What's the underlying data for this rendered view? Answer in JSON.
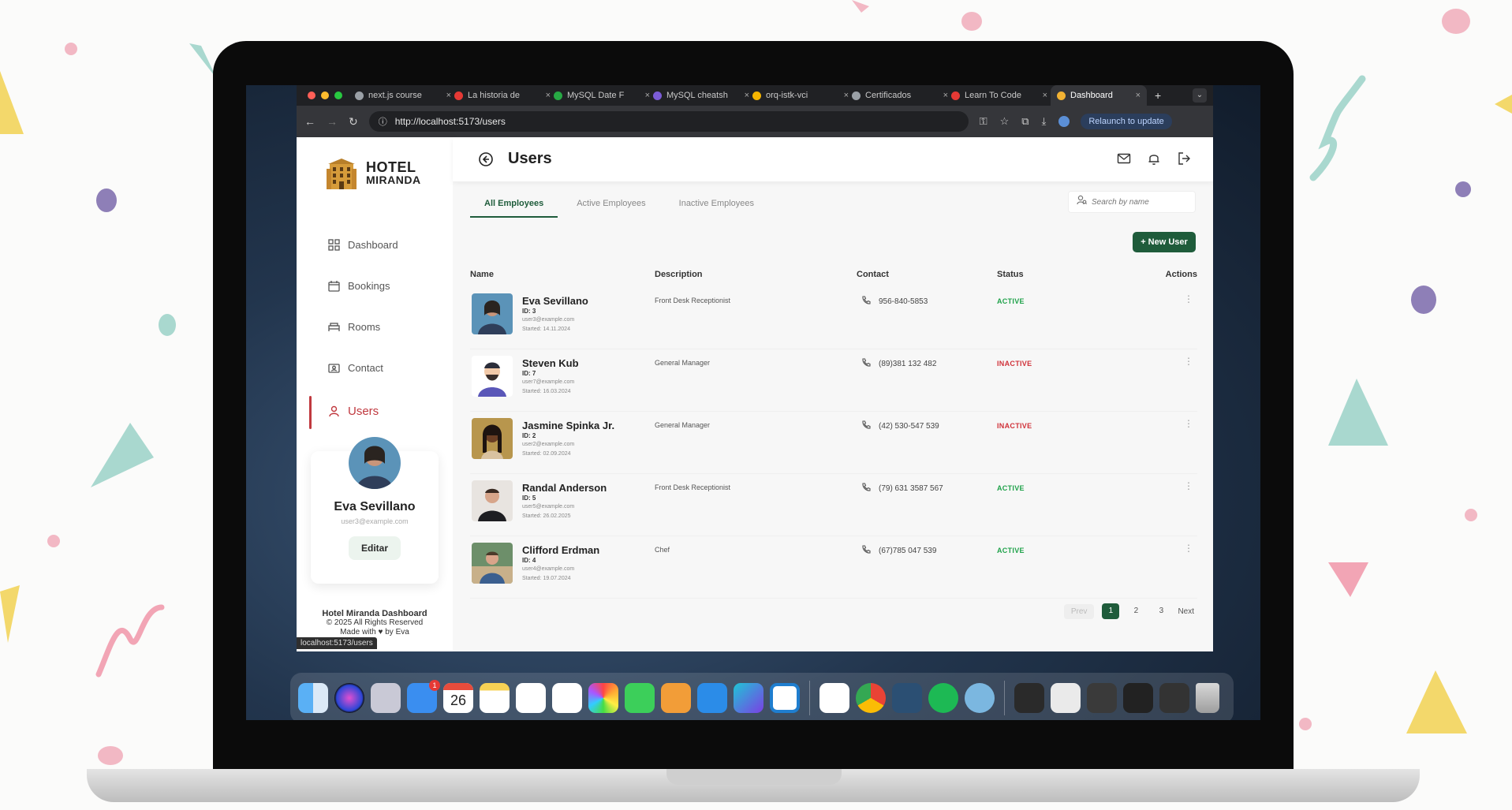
{
  "browser": {
    "tabs": [
      {
        "title": "next.js course",
        "color": "#9aa0a6"
      },
      {
        "title": "La historia de",
        "color": "#e53935"
      },
      {
        "title": "MySQL Date F",
        "color": "#27a844"
      },
      {
        "title": "MySQL cheatsh",
        "color": "#7b5cd6"
      },
      {
        "title": "orq-istk-vci",
        "color": "#f4b400"
      },
      {
        "title": "Certificados",
        "color": "#9aa0a6"
      },
      {
        "title": "Learn To Code",
        "color": "#e53935"
      },
      {
        "title": "Dashboard",
        "color": "#f2b233"
      }
    ],
    "url": "http://localhost:5173/users",
    "relaunch_label": "Relaunch to update",
    "status_url": "localhost:5173/users"
  },
  "sidebar": {
    "logo_line1": "HOTEL",
    "logo_line2": "MIRANDA",
    "items": [
      {
        "label": "Dashboard",
        "icon": "dashboard-icon"
      },
      {
        "label": "Bookings",
        "icon": "calendar-icon"
      },
      {
        "label": "Rooms",
        "icon": "bed-icon"
      },
      {
        "label": "Contact",
        "icon": "contact-icon"
      },
      {
        "label": "Users",
        "icon": "user-icon"
      }
    ],
    "profile": {
      "name": "Eva Sevillano",
      "email": "user3@example.com",
      "edit_label": "Editar"
    },
    "footer": {
      "title": "Hotel Miranda Dashboard",
      "rights": "© 2025 All Rights Reserved",
      "made": "Made with ♥ by Eva"
    }
  },
  "header": {
    "title": "Users"
  },
  "filters": {
    "tabs": [
      "All Employees",
      "Active Employees",
      "Inactive Employees"
    ],
    "search_placeholder": "Search by name",
    "new_user_label": "+ New User"
  },
  "table": {
    "columns": [
      "Name",
      "Description",
      "Contact",
      "Status",
      "Actions"
    ],
    "rows": [
      {
        "name": "Eva Sevillano",
        "id": "ID: 3",
        "email": "user3@example.com",
        "started": "Started: 14.11.2024",
        "description": "Front Desk Receptionist",
        "contact": "956-840-5853",
        "status": "ACTIVE"
      },
      {
        "name": "Steven Kub",
        "id": "ID: 7",
        "email": "user7@example.com",
        "started": "Started: 16.03.2024",
        "description": "General Manager",
        "contact": "(89)381 132 482",
        "status": "INACTIVE"
      },
      {
        "name": "Jasmine Spinka Jr.",
        "id": "ID: 2",
        "email": "user2@example.com",
        "started": "Started: 02.09.2024",
        "description": "General Manager",
        "contact": "(42) 530-547 539",
        "status": "INACTIVE"
      },
      {
        "name": "Randal Anderson",
        "id": "ID: 5",
        "email": "user5@example.com",
        "started": "Started: 26.02.2025",
        "description": "Front Desk Receptionist",
        "contact": "(79) 631 3587 567",
        "status": "ACTIVE"
      },
      {
        "name": "Clifford Erdman",
        "id": "ID: 4",
        "email": "user4@example.com",
        "started": "Started: 19.07.2024",
        "description": "Chef",
        "contact": "(67)785 047 539",
        "status": "ACTIVE"
      }
    ]
  },
  "pagination": {
    "prev": "Prev",
    "pages": [
      "1",
      "2",
      "3"
    ],
    "next": "Next",
    "current": "1"
  },
  "colors": {
    "accent": "#1f5c3b",
    "active": "#1fa24a",
    "inactive": "#d0323a",
    "nav_active": "#c0393f"
  },
  "dock": {
    "calendar_day": "26",
    "mail_badge": "1"
  }
}
